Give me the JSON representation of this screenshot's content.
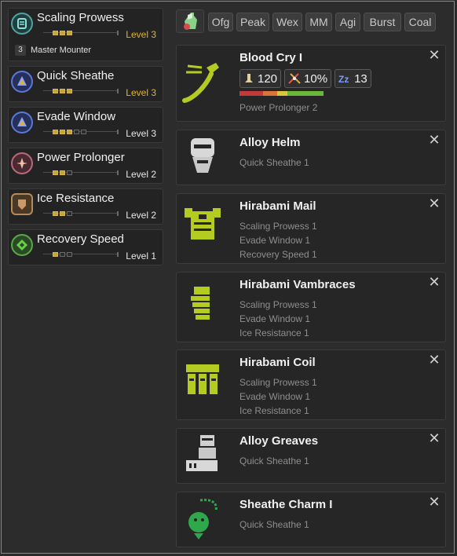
{
  "skills": [
    {
      "name": "Scaling Prowess",
      "level": "Level 3",
      "pips": 3,
      "filled": 3,
      "gold": true,
      "sub_count": "3",
      "sub_label": "Master Mounter",
      "icon": "scaling-prowess-icon",
      "icon_color": "#4fa3a0"
    },
    {
      "name": "Quick Sheathe",
      "level": "Level 3",
      "pips": 3,
      "filled": 3,
      "gold": true,
      "icon": "quick-sheathe-icon",
      "icon_color": "#5a78d8"
    },
    {
      "name": "Evade Window",
      "level": "Level 3",
      "pips": 5,
      "filled": 3,
      "gold": false,
      "icon": "evade-window-icon",
      "icon_color": "#5a78d8"
    },
    {
      "name": "Power Prolonger",
      "level": "Level 2",
      "pips": 3,
      "filled": 2,
      "gold": false,
      "icon": "power-prolonger-icon",
      "icon_color": "#b86a7a"
    },
    {
      "name": "Ice Resistance",
      "level": "Level 2",
      "pips": 3,
      "filled": 2,
      "gold": false,
      "icon": "ice-resistance-icon",
      "icon_color": "#b58a5a"
    },
    {
      "name": "Recovery Speed",
      "level": "Level 1",
      "pips": 3,
      "filled": 1,
      "gold": false,
      "icon": "recovery-speed-icon",
      "icon_color": "#5aa84a"
    }
  ],
  "filters": [
    "Ofg",
    "Peak",
    "Wex",
    "MM",
    "Agi",
    "Burst",
    "Coal"
  ],
  "weapon": {
    "name": "Blood Cry I",
    "attack": "120",
    "affinity": "10%",
    "element": "13",
    "skill": "Power Prolonger 2",
    "sharpness": [
      {
        "color": "#c23a3a",
        "fraction": 0.28
      },
      {
        "color": "#d9743a",
        "fraction": 0.17
      },
      {
        "color": "#d9c63a",
        "fraction": 0.12
      },
      {
        "color": "#6ab83a",
        "fraction": 0.43
      }
    ]
  },
  "armor": [
    {
      "name": "Alloy Helm",
      "skills": [
        "Quick Sheathe 1"
      ],
      "icon": "helm-icon"
    },
    {
      "name": "Hirabami Mail",
      "skills": [
        "Scaling Prowess 1",
        "Evade Window 1",
        "Recovery Speed 1"
      ],
      "icon": "chest-icon"
    },
    {
      "name": "Hirabami Vambraces",
      "skills": [
        "Scaling Prowess 1",
        "Evade Window 1",
        "Ice Resistance 1"
      ],
      "icon": "arms-icon"
    },
    {
      "name": "Hirabami Coil",
      "skills": [
        "Scaling Prowess 1",
        "Evade Window 1",
        "Ice Resistance 1"
      ],
      "icon": "waist-icon"
    },
    {
      "name": "Alloy Greaves",
      "skills": [
        "Quick Sheathe 1"
      ],
      "icon": "legs-icon"
    },
    {
      "name": "Sheathe Charm I",
      "skills": [
        "Quick Sheathe 1"
      ],
      "icon": "charm-icon"
    }
  ],
  "close_glyph": "✕",
  "colors": {
    "gold": "#e0b52c",
    "lime": "#b4cc22"
  }
}
